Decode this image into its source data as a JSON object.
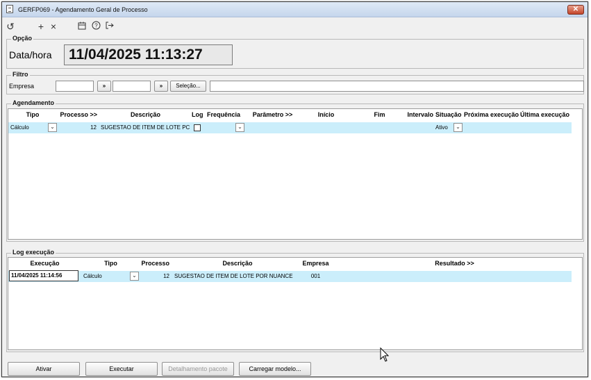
{
  "window": {
    "title": "GERFP069 - Agendamento Geral de Processo",
    "close_glyph": "✕"
  },
  "toolbar": [
    {
      "name": "refresh-icon",
      "glyph": "↺"
    },
    {
      "name": "add-icon",
      "glyph": "+"
    },
    {
      "name": "delete-icon",
      "glyph": "×"
    },
    {
      "name": "calendar-icon",
      "glyph": "▭"
    },
    {
      "name": "help-icon",
      "glyph": "?"
    },
    {
      "name": "exit-icon",
      "glyph": "↦"
    }
  ],
  "opcao": {
    "legend": "Opção",
    "label": "Data/hora",
    "value": "11/04/2025 11:13:27"
  },
  "filtro": {
    "legend": "Filtro",
    "empresa_label": "Empresa",
    "arrow_label": "»",
    "selecao_label": "Seleção..."
  },
  "agendamento": {
    "legend": "Agendamento",
    "columns": {
      "tipo": "Tipo",
      "processo": "Processo >>",
      "descricao": "Descrição",
      "log": "Log",
      "frequencia": "Frequência",
      "parametro": "Parâmetro >>",
      "inicio": "Início",
      "fim": "Fim",
      "intervalo": "Intervalo",
      "situacao": "Situação",
      "proxima": "Próxima execução",
      "ultima": "Última execução"
    },
    "rows": [
      {
        "tipo": "Cálculo",
        "processo": "12",
        "descricao": "SUGESTAO DE ITEM DE LOTE PC",
        "situacao": "Ativo"
      }
    ]
  },
  "log_execucao": {
    "legend": "Log execução",
    "columns": {
      "execucao": "Execução",
      "tipo": "Tipo",
      "processo": "Processo",
      "descricao": "Descrição",
      "empresa": "Empresa",
      "resultado": "Resultado >>"
    },
    "rows": [
      {
        "execucao": "11/04/2025 11:14:56",
        "tipo": "Cálculo",
        "processo": "12",
        "descricao": "SUGESTAO DE ITEM DE LOTE POR NUANCE",
        "empresa": "001"
      }
    ]
  },
  "buttons": {
    "ativar": "Ativar",
    "executar": "Executar",
    "detalhamento": "Detalhamento pacote",
    "carregar": "Carregar modelo..."
  }
}
